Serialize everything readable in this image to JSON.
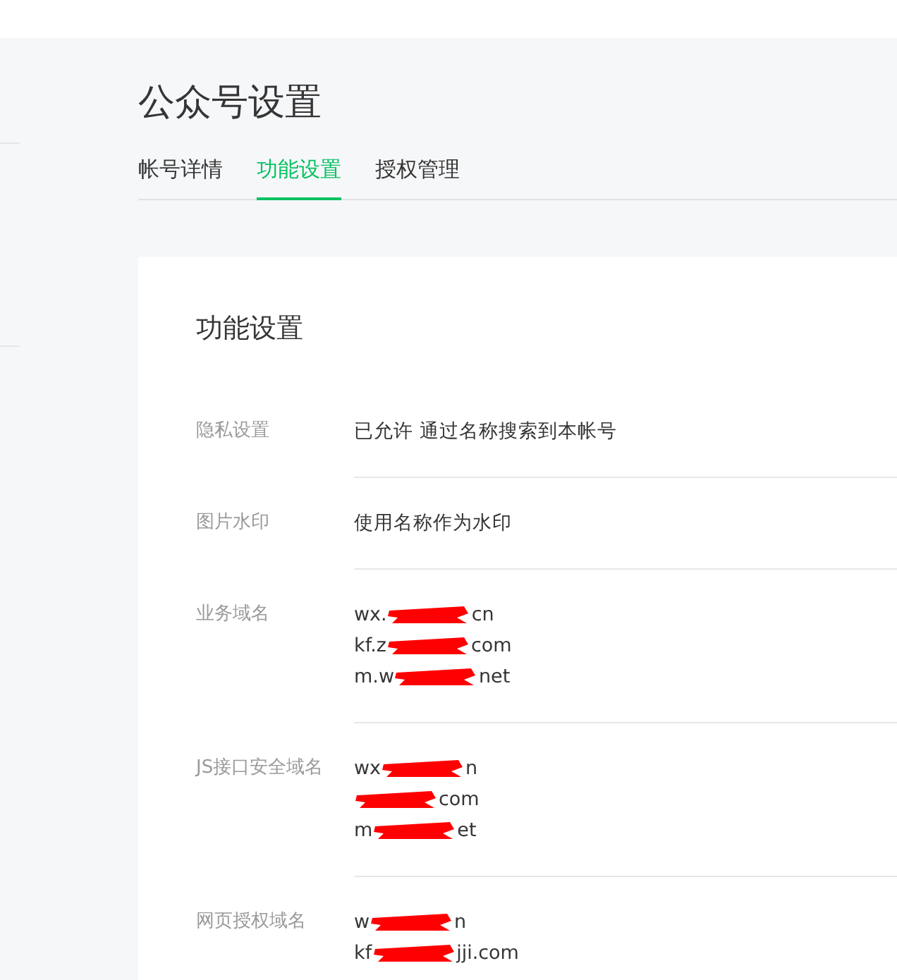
{
  "page_title": "公众号设置",
  "tabs": [
    {
      "label": "帐号详情",
      "selected": false
    },
    {
      "label": "功能设置",
      "selected": true
    },
    {
      "label": "授权管理",
      "selected": false
    }
  ],
  "card": {
    "title": "功能设置",
    "rows": [
      {
        "label": "隐私设置",
        "values": [
          {
            "text": "已允许 通过名称搜索到本帐号"
          }
        ]
      },
      {
        "label": "图片水印",
        "values": [
          {
            "text": "使用名称作为水印"
          }
        ]
      },
      {
        "label": "业务域名",
        "values": [
          {
            "head": "wx.",
            "tail": "cn"
          },
          {
            "head": "kf.z",
            "tail": "com"
          },
          {
            "head": "m.w",
            "tail": "net"
          }
        ]
      },
      {
        "label": "JS接口安全域名",
        "values": [
          {
            "head": "wx",
            "tail": "n"
          },
          {
            "tail": "com"
          },
          {
            "head": "m",
            "tail": "et"
          }
        ]
      },
      {
        "label": "网页授权域名",
        "values": [
          {
            "head": "w",
            "tail": "n"
          },
          {
            "head": "kf",
            "tail": "jji.com"
          }
        ]
      }
    ]
  }
}
